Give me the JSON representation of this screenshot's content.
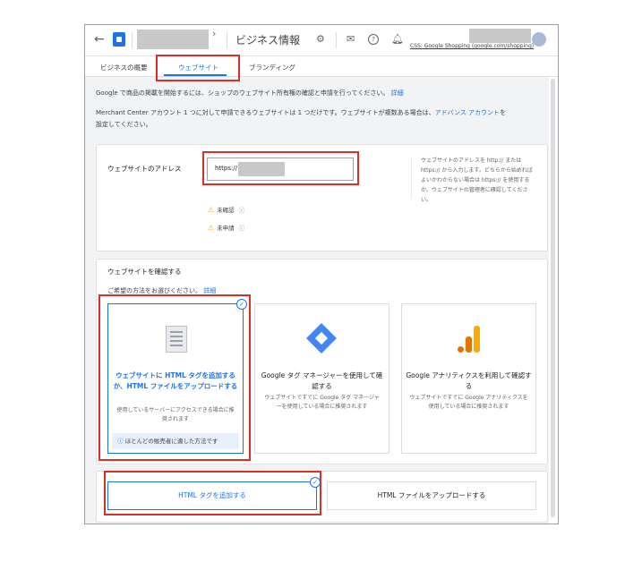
{
  "appbar": {
    "title": "ビジネス情報",
    "css_label": "CSS: Google Shopping (google.com/shopping)",
    "chevron": "›"
  },
  "tabs": [
    {
      "label": "ビジネスの概要",
      "active": false
    },
    {
      "label": "ウェブサイト",
      "active": true
    },
    {
      "label": "ブランディング",
      "active": false
    }
  ],
  "intro": {
    "line1": "Google で商品の掲載を開始するには、ショップのウェブサイト所有権の確認と申請を行ってください。",
    "line1_link": "詳細",
    "line2a": "Merchant Center アカウント 1 つに対して申請できるウェブサイトは 1 つだけです。ウェブサイトが複数ある場合は、",
    "line2_link": "アドバンス アカウント",
    "line2b": "を",
    "line3": "設定してください。"
  },
  "website": {
    "label": "ウェブサイトのアドレス",
    "url_prefix": "https://",
    "help": "ウェブサイトのアドレスを http:// または https:// から入力します。どちらから始めればよいかわからない場合は https:// を使用するか、ウェブサイトの管理者に確認してください。",
    "status_unverified": "未確認",
    "status_unclaimed": "未申請"
  },
  "verify": {
    "title": "ウェブサイトを確認する",
    "prompt": "ご希望の方法をお選びください。",
    "prompt_link": "詳細",
    "options": [
      {
        "title": "ウェブサイトに HTML タグを追加するか、HTML ファイルをアップロードする",
        "sub": "使用しているサーバーにアクセスできる場合に推奨されます",
        "note": "ほとんどの販売者に適した方法です",
        "selected": true
      },
      {
        "title": "Google タグ マネージャーを使用して確認する",
        "sub": "ウェブサイトですでに Google タグ マネージャーを使用している場合に推奨されます",
        "selected": false
      },
      {
        "title": "Google アナリティクスを利用して確認する",
        "sub": "ウェブサイトですでに Google アナリティクスを使用している場合に推奨されます",
        "selected": false
      }
    ]
  },
  "actions": {
    "add_tag": "HTML タグを追加する",
    "upload_file": "HTML ファイルをアップロードする"
  },
  "colors": {
    "accent": "#1a73e8",
    "highlight": "#d93025",
    "warning": "#f9ab00"
  }
}
